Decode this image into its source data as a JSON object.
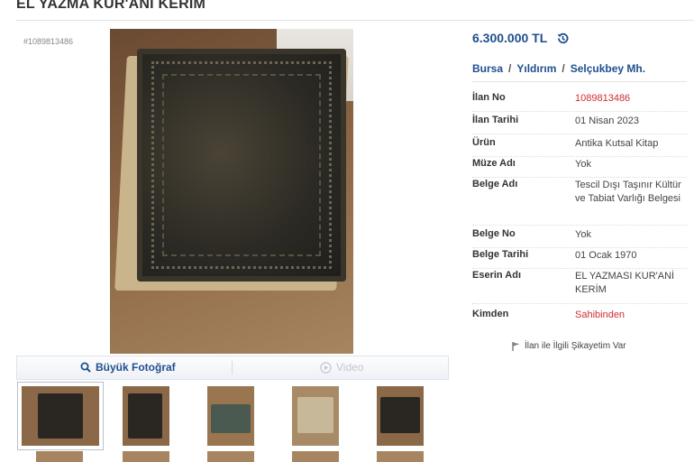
{
  "page_title": "EL YAZMA KUR'ANİ KERİM",
  "ad_id": "#1089813486",
  "gallery": {
    "large_photo_label": "Büyük Fotoğraf",
    "video_label": "Video",
    "thumbnail_count": 5
  },
  "price": "6.300.000 TL",
  "breadcrumb": [
    "Bursa",
    "Yıldırım",
    "Selçukbey Mh."
  ],
  "details": [
    {
      "label": "İlan No",
      "value": "1089813486"
    },
    {
      "label": "İlan Tarihi",
      "value": "01 Nisan 2023"
    },
    {
      "label": "Ürün",
      "value": "Antika Kutsal Kitap"
    },
    {
      "label": "Müze Adı",
      "value": "Yok"
    },
    {
      "label": "Belge Adı",
      "value": "Tescil Dışı Taşınır Kültür ve Tabiat Varlığı Belgesi"
    },
    {
      "label": "Belge No",
      "value": "Yok"
    },
    {
      "label": "Belge Tarihi",
      "value": "01 Ocak 1970"
    },
    {
      "label": "Eserin Adı",
      "value": "EL YAZMASI KUR'ANİ KERİM"
    },
    {
      "label": "Kimden",
      "value": "Sahibinden"
    }
  ],
  "complaint_link": "İlan ile İlgili Şikayetim Var",
  "colors": {
    "link_blue": "#1f4f8f",
    "highlight_red": "#d12e2e"
  },
  "icons": {
    "price_history": "history-icon",
    "zoom": "magnifier-icon",
    "video": "play-icon",
    "flag": "flag-icon"
  }
}
